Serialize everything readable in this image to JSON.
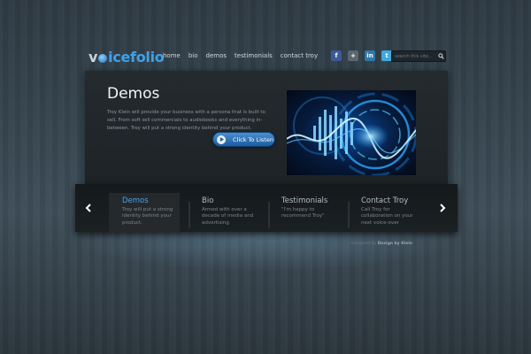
{
  "logo": {
    "part1": "v",
    "part2": "icefolio"
  },
  "nav": [
    {
      "label": "home"
    },
    {
      "label": "bio"
    },
    {
      "label": "demos"
    },
    {
      "label": "testimonials"
    },
    {
      "label": "contact troy"
    }
  ],
  "social": [
    {
      "name": "facebook",
      "glyph": "f"
    },
    {
      "name": "google-plus",
      "glyph": "+"
    },
    {
      "name": "linkedin",
      "glyph": "in"
    },
    {
      "name": "twitter",
      "glyph": "t"
    }
  ],
  "search": {
    "placeholder": "search this site..."
  },
  "hero": {
    "title": "Demos",
    "text": "Troy Klein will provide your business with a persona that is built to sell. From soft sell commercials to audiobooks and everything in-between, Troy will put a strong identity behind your product.",
    "cta_label": "Click To Listen"
  },
  "slides": [
    {
      "title": "Demos",
      "desc": "Troy will put a strong identity behind your product."
    },
    {
      "title": "Bio",
      "desc": "Armed with over a decade of media and advertising"
    },
    {
      "title": "Testimonials",
      "desc": "\"I'm happy to recommend Troy\""
    },
    {
      "title": "Contact Troy",
      "desc": "Call Troy for collaboration on your next voice-over"
    }
  ],
  "footer": {
    "prefix": "Designed by",
    "brand": "Design by Klein"
  },
  "colors": {
    "accent": "#4aa3ea",
    "button": "#2e75b8"
  }
}
